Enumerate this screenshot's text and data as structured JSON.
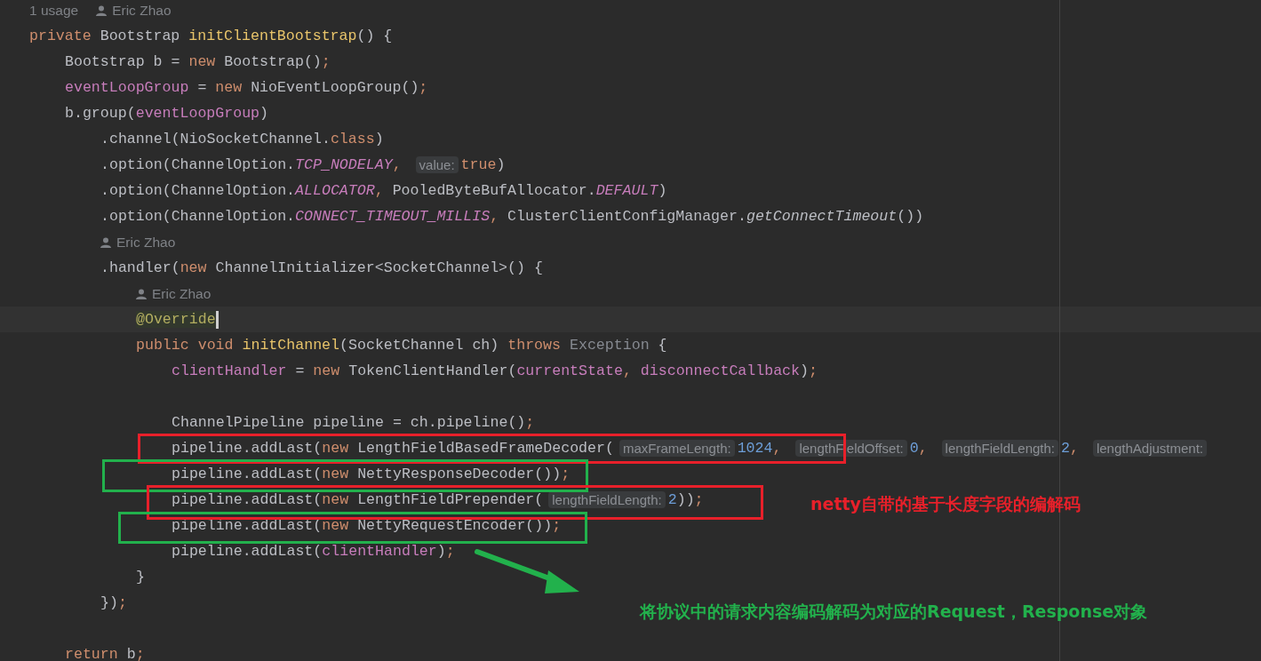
{
  "editor": {
    "lines": [
      {
        "kind": "meta",
        "usage": "1 usage",
        "author": "Eric Zhao"
      },
      {
        "kind": "code",
        "tokens": [
          {
            "t": "private ",
            "kind": "keyword"
          },
          {
            "t": "Bootstrap ",
            "kind": "plain"
          },
          {
            "t": "initClientBootstrap",
            "kind": "decl"
          },
          {
            "t": "() {",
            "kind": "plain"
          }
        ],
        "children": [
          {
            "kind": "code",
            "tokens": [
              {
                "t": "Bootstrap b = ",
                "kind": "plain"
              },
              {
                "t": "new ",
                "kind": "keyword"
              },
              {
                "t": "Bootstrap()",
                "kind": "plain"
              },
              {
                "t": ";",
                "kind": "keyword"
              }
            ]
          },
          {
            "kind": "code",
            "tokens": [
              {
                "t": "eventLoopGroup",
                "kind": "field"
              },
              {
                "t": " = ",
                "kind": "plain"
              },
              {
                "t": "new ",
                "kind": "keyword"
              },
              {
                "t": "NioEventLoopGroup()",
                "kind": "plain"
              },
              {
                "t": ";",
                "kind": "keyword"
              }
            ]
          },
          {
            "kind": "code",
            "tokens": [
              {
                "t": "b.group(",
                "kind": "plain"
              },
              {
                "t": "eventLoopGroup",
                "kind": "field"
              },
              {
                "t": ")",
                "kind": "plain"
              }
            ],
            "children": [
              {
                "kind": "code",
                "tokens": [
                  {
                    "t": ".channel(NioSocketChannel.",
                    "kind": "plain"
                  },
                  {
                    "t": "class",
                    "kind": "keyword"
                  },
                  {
                    "t": ")",
                    "kind": "plain"
                  }
                ]
              },
              {
                "kind": "code",
                "tokens": [
                  {
                    "t": ".option(ChannelOption.",
                    "kind": "plain"
                  },
                  {
                    "t": "TCP_NODELAY",
                    "kind": "static"
                  },
                  {
                    "t": ", ",
                    "kind": "keyword"
                  },
                  {
                    "t": "value:",
                    "kind": "hint"
                  },
                  {
                    "t": "true",
                    "kind": "keyword"
                  },
                  {
                    "t": ")",
                    "kind": "plain"
                  }
                ]
              },
              {
                "kind": "code",
                "tokens": [
                  {
                    "t": ".option(ChannelOption.",
                    "kind": "plain"
                  },
                  {
                    "t": "ALLOCATOR",
                    "kind": "static"
                  },
                  {
                    "t": ", ",
                    "kind": "keyword"
                  },
                  {
                    "t": "PooledByteBufAllocator.",
                    "kind": "plain"
                  },
                  {
                    "t": "DEFAULT",
                    "kind": "static"
                  },
                  {
                    "t": ")",
                    "kind": "plain"
                  }
                ]
              },
              {
                "kind": "code",
                "tokens": [
                  {
                    "t": ".option(ChannelOption.",
                    "kind": "plain"
                  },
                  {
                    "t": "CONNECT_TIMEOUT_MILLIS",
                    "kind": "static"
                  },
                  {
                    "t": ", ",
                    "kind": "keyword"
                  },
                  {
                    "t": "ClusterClientConfigManager.",
                    "kind": "plain"
                  },
                  {
                    "t": "getConnectTimeout",
                    "kind": "staticcall"
                  },
                  {
                    "t": "())",
                    "kind": "plain"
                  }
                ]
              },
              {
                "kind": "author",
                "author": "Eric Zhao"
              },
              {
                "kind": "code",
                "tokens": [
                  {
                    "t": ".handler(",
                    "kind": "plain"
                  },
                  {
                    "t": "new ",
                    "kind": "keyword"
                  },
                  {
                    "t": "ChannelInitializer<SocketChannel>() {",
                    "kind": "plain"
                  }
                ],
                "children": [
                  {
                    "kind": "author",
                    "author": "Eric Zhao"
                  },
                  {
                    "kind": "code",
                    "current": true,
                    "tokens": [
                      {
                        "t": "@Override",
                        "kind": "annotation"
                      }
                    ]
                  },
                  {
                    "kind": "code",
                    "tokens": [
                      {
                        "t": "public void ",
                        "kind": "keyword"
                      },
                      {
                        "t": "initChannel",
                        "kind": "decl"
                      },
                      {
                        "t": "(SocketChannel ch) ",
                        "kind": "plain"
                      },
                      {
                        "t": "throws ",
                        "kind": "keyword"
                      },
                      {
                        "t": "Exception",
                        "kind": "unused"
                      },
                      {
                        "t": " {",
                        "kind": "plain"
                      }
                    ],
                    "children": [
                      {
                        "kind": "code",
                        "tokens": [
                          {
                            "t": "clientHandler",
                            "kind": "field"
                          },
                          {
                            "t": " = ",
                            "kind": "plain"
                          },
                          {
                            "t": "new ",
                            "kind": "keyword"
                          },
                          {
                            "t": "TokenClientHandler(",
                            "kind": "plain"
                          },
                          {
                            "t": "currentState",
                            "kind": "field"
                          },
                          {
                            "t": ", ",
                            "kind": "keyword"
                          },
                          {
                            "t": "disconnectCallback",
                            "kind": "field"
                          },
                          {
                            "t": ")",
                            "kind": "plain"
                          },
                          {
                            "t": ";",
                            "kind": "keyword"
                          }
                        ]
                      },
                      {
                        "kind": "blank"
                      },
                      {
                        "kind": "code",
                        "tokens": [
                          {
                            "t": "ChannelPipeline pipeline = ch.pipeline()",
                            "kind": "plain"
                          },
                          {
                            "t": ";",
                            "kind": "keyword"
                          }
                        ]
                      },
                      {
                        "kind": "code",
                        "tokens": [
                          {
                            "t": "pipeline.addLast(",
                            "kind": "plain"
                          },
                          {
                            "t": "new ",
                            "kind": "keyword"
                          },
                          {
                            "t": "LengthFieldBasedFrameDecoder(",
                            "kind": "plain"
                          },
                          {
                            "t": "maxFrameLength:",
                            "kind": "hint"
                          },
                          {
                            "t": "1024",
                            "kind": "number"
                          },
                          {
                            "t": ", ",
                            "kind": "keyword"
                          },
                          {
                            "t": "lengthFieldOffset:",
                            "kind": "hint"
                          },
                          {
                            "t": "0",
                            "kind": "number"
                          },
                          {
                            "t": ", ",
                            "kind": "keyword"
                          },
                          {
                            "t": "lengthFieldLength:",
                            "kind": "hint"
                          },
                          {
                            "t": "2",
                            "kind": "number"
                          },
                          {
                            "t": ", ",
                            "kind": "keyword"
                          },
                          {
                            "t": "lengthAdjustment:",
                            "kind": "hint"
                          }
                        ]
                      },
                      {
                        "kind": "code",
                        "tokens": [
                          {
                            "t": "pipeline.addLast(",
                            "kind": "plain"
                          },
                          {
                            "t": "new ",
                            "kind": "keyword"
                          },
                          {
                            "t": "NettyResponseDecoder())",
                            "kind": "plain"
                          },
                          {
                            "t": ";",
                            "kind": "keyword"
                          }
                        ]
                      },
                      {
                        "kind": "code",
                        "tokens": [
                          {
                            "t": "pipeline.addLast(",
                            "kind": "plain"
                          },
                          {
                            "t": "new ",
                            "kind": "keyword"
                          },
                          {
                            "t": "LengthFieldPrepender(",
                            "kind": "plain"
                          },
                          {
                            "t": "lengthFieldLength:",
                            "kind": "hint"
                          },
                          {
                            "t": "2",
                            "kind": "number"
                          },
                          {
                            "t": "))",
                            "kind": "plain"
                          },
                          {
                            "t": ";",
                            "kind": "keyword"
                          }
                        ]
                      },
                      {
                        "kind": "code",
                        "tokens": [
                          {
                            "t": "pipeline.addLast(",
                            "kind": "plain"
                          },
                          {
                            "t": "new ",
                            "kind": "keyword"
                          },
                          {
                            "t": "NettyRequestEncoder())",
                            "kind": "plain"
                          },
                          {
                            "t": ";",
                            "kind": "keyword"
                          }
                        ]
                      },
                      {
                        "kind": "code",
                        "tokens": [
                          {
                            "t": "pipeline.addLast(",
                            "kind": "plain"
                          },
                          {
                            "t": "clientHandler",
                            "kind": "field"
                          },
                          {
                            "t": ")",
                            "kind": "plain"
                          },
                          {
                            "t": ";",
                            "kind": "keyword"
                          }
                        ]
                      }
                    ]
                  },
                  {
                    "kind": "code",
                    "tokens": [
                      {
                        "t": "}",
                        "kind": "plain"
                      }
                    ]
                  }
                ]
              },
              {
                "kind": "code",
                "tokens": [
                  {
                    "t": "})",
                    "kind": "plain"
                  },
                  {
                    "t": ";",
                    "kind": "keyword"
                  }
                ]
              }
            ]
          },
          {
            "kind": "blank"
          },
          {
            "kind": "code",
            "tokens": [
              {
                "t": "return ",
                "kind": "keyword"
              },
              {
                "t": "b",
                "kind": "plain"
              },
              {
                "t": ";",
                "kind": "keyword"
              }
            ]
          }
        ]
      }
    ]
  },
  "annotations": [
    {
      "kind": "box",
      "color": "#e8202a"
    },
    {
      "kind": "box",
      "color": "#22b14c"
    },
    {
      "kind": "box",
      "color": "#e8202a"
    },
    {
      "kind": "box",
      "color": "#22b14c"
    },
    {
      "kind": "arrow",
      "color": "#22b14c"
    },
    {
      "kind": "label",
      "color": "#e8202a",
      "text": "netty自带的基于长度字段的编解码"
    },
    {
      "kind": "label",
      "color": "#22b14c",
      "text": "将协议中的请求内容编码解码为对应的Request，Response对象"
    }
  ]
}
